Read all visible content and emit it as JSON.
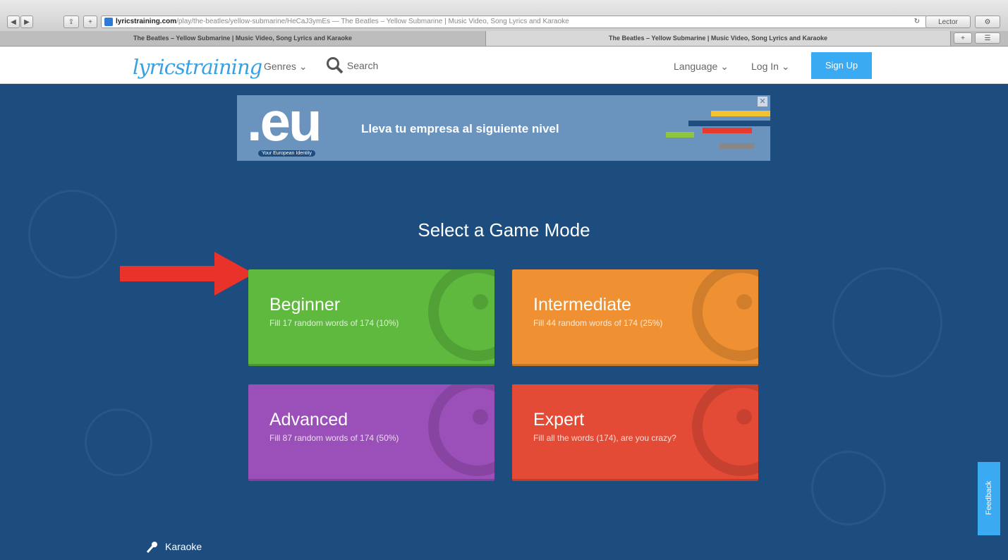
{
  "browser": {
    "url_host": "lyricstraining.com",
    "url_path": "/play/the-beatles/yellow-submarine/HeCaJ3ymEs — The Beatles – Yellow Submarine | Music Video, Song Lyrics and Karaoke",
    "reader_label": "Lector",
    "tabs": [
      {
        "label": "The Beatles – Yellow Submarine | Music Video, Song Lyrics and Karaoke"
      },
      {
        "label": "The Beatles – Yellow Submarine | Music Video, Song Lyrics and Karaoke"
      }
    ]
  },
  "header": {
    "logo_text": "lyricstraining",
    "genres_label": "Genres",
    "search_label": "Search",
    "language_label": "Language",
    "login_label": "Log In",
    "signup_label": "Sign Up"
  },
  "ad": {
    "brand": ".eu",
    "tagline": "Your European Identity",
    "text": "Lleva tu empresa al siguiente nivel"
  },
  "main": {
    "headline": "Select a Game Mode",
    "modes": [
      {
        "title": "Beginner",
        "desc": "Fill 17 random words of 174 (10%)",
        "color": "#5eb93e"
      },
      {
        "title": "Intermediate",
        "desc": "Fill 44 random words of 174 (25%)",
        "color": "#ef9133"
      },
      {
        "title": "Advanced",
        "desc": "Fill 87 random words of 174 (50%)",
        "color": "#9b4fb9"
      },
      {
        "title": "Expert",
        "desc": "Fill all the words (174), are you crazy?",
        "color": "#e44b36"
      }
    ],
    "karaoke_label": "Karaoke",
    "feedback_label": "Feedback"
  },
  "colors": {
    "background": "#1d4d7f",
    "accent": "#3aaaf2",
    "arrow": "#e8322a"
  }
}
